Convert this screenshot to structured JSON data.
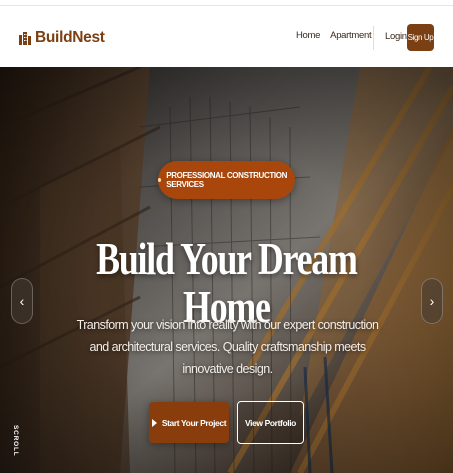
{
  "brand": {
    "name": "BuildNest",
    "icon": "building-icon"
  },
  "nav": {
    "links": [
      {
        "label": "Home"
      },
      {
        "label": "Apartment"
      }
    ],
    "login_label": "Login",
    "signup_label": "Sign Up"
  },
  "hero": {
    "badge_text": "PROFESSIONAL CONSTRUCTION SERVICES",
    "title": "Build Your Dream Home",
    "subtitle": "Transform your vision into reality with our expert construction and architectural services. Quality craftsmanship meets innovative design.",
    "primary_button": "Start Your Project",
    "secondary_button": "View Portfolio",
    "scroll_label": "SCROLL",
    "prev_arrow": "‹",
    "next_arrow": "›"
  },
  "colors": {
    "brand": "#7a3f12",
    "accent": "#a8460c",
    "button_primary": "#8a3d0c"
  }
}
